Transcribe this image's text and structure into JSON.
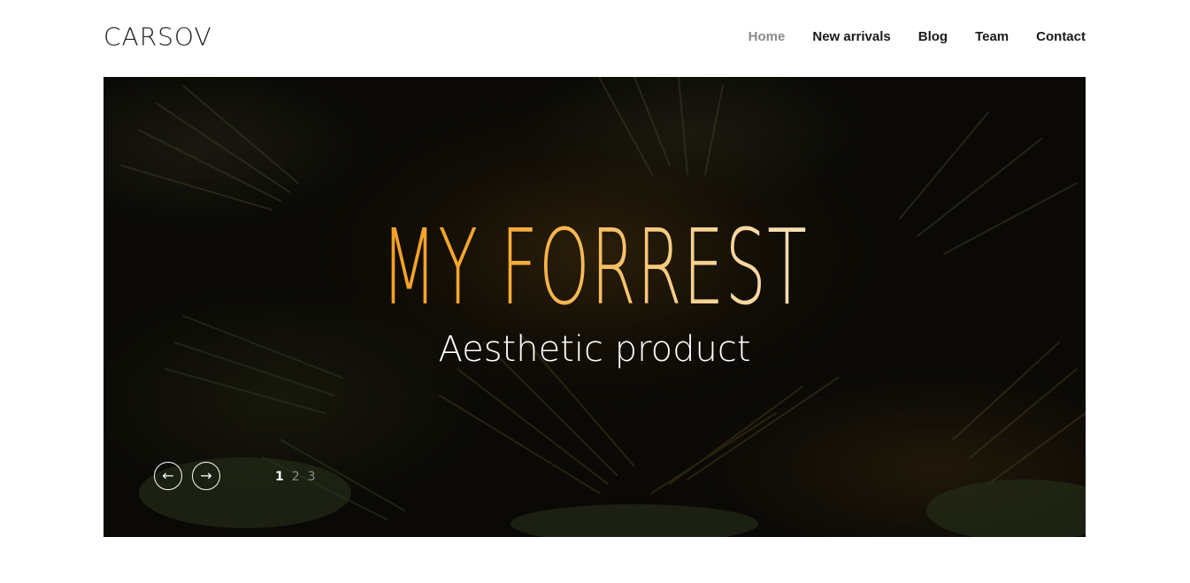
{
  "header": {
    "logo": "CARSOV",
    "nav": [
      {
        "label": "Home",
        "active": true
      },
      {
        "label": "New arrivals",
        "active": false
      },
      {
        "label": "Blog",
        "active": false
      },
      {
        "label": "Team",
        "active": false
      },
      {
        "label": "Contact",
        "active": false
      }
    ]
  },
  "hero": {
    "title": "MY FORREST",
    "subtitle": "Aesthetic product",
    "prev_icon": "arrow-left-icon",
    "next_icon": "arrow-right-icon",
    "prev_glyph": "←",
    "next_glyph": "→",
    "pages": [
      "1",
      "2",
      "3"
    ],
    "current_page": "1"
  },
  "colors": {
    "title_gradient_start": "#f39a18",
    "title_gradient_end": "#f8ecd9",
    "nav_active": "#8a8a8a",
    "nav_text": "#1a1a1a"
  }
}
